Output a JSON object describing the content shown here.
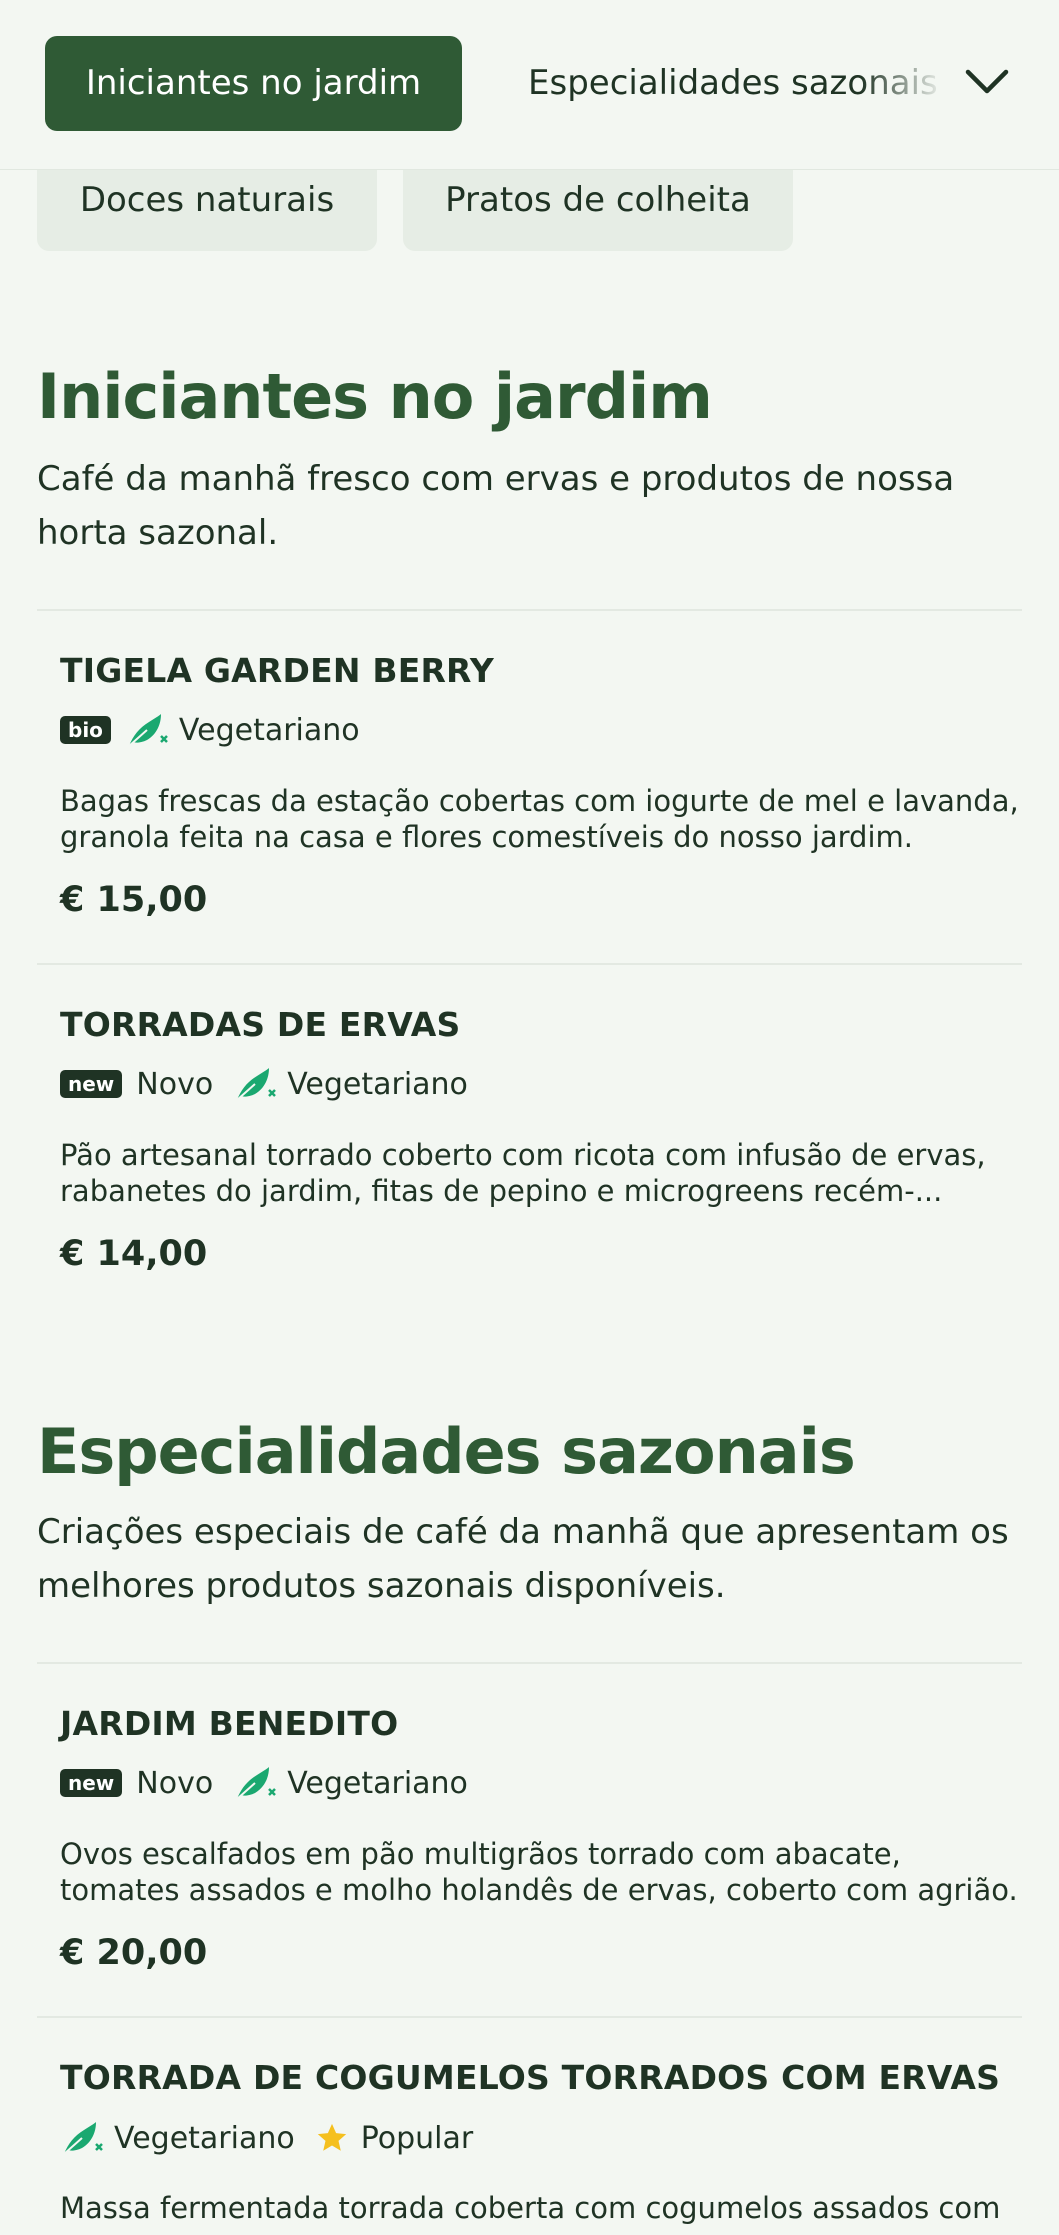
{
  "category_nav": {
    "active_tab": "Iniciantes no jardim",
    "next_tab": "Especialidades sazonais",
    "chips": [
      "Doces naturais",
      "Pratos de colheita"
    ],
    "expand_icon": "chevron-down-icon"
  },
  "colors": {
    "accent": "#2f5a35",
    "background": "#f3f7f2",
    "text": "#1f3324",
    "leaf": "#1aa870",
    "star": "#f5c01e"
  },
  "sections": [
    {
      "title": "Iniciantes no jardim",
      "description": "Café da manhã fresco com ervas e produtos de nossa horta sazonal.",
      "items": [
        {
          "name": "TIGELA GARDEN BERRY",
          "badge": "bio",
          "badge_label": "",
          "diet": "Vegetariano",
          "description": "Bagas frescas da estação cobertas com iogurte de mel e lavanda, granola feita na casa e flores comestíveis do nosso jardim.",
          "price": "€ 15,00"
        },
        {
          "name": "TORRADAS DE ERVAS",
          "badge": "new",
          "badge_label": "Novo",
          "diet": "Vegetariano",
          "description": "Pão artesanal torrado coberto com ricota com infusão de ervas, rabanetes do jardim, fitas de pepino e microgreens recém-...",
          "price": "€ 14,00"
        }
      ]
    },
    {
      "title": "Especialidades sazonais",
      "description": "Criações especiais de café da manhã que apresentam os melhores produtos sazonais disponíveis.",
      "items": [
        {
          "name": "JARDIM BENEDITO",
          "badge": "new",
          "badge_label": "Novo",
          "diet": "Vegetariano",
          "description": "Ovos escalfados em pão multigrãos torrado com abacate, tomates assados e molho holandês de ervas, coberto com agrião.",
          "price": "€ 20,00"
        },
        {
          "name": "TORRADA DE COGUMELOS TORRADOS COM ERVAS",
          "diet": "Vegetariano",
          "popular_label": "Popular",
          "description": "Massa fermentada torrada coberta com cogumelos assados com"
        }
      ]
    }
  ]
}
